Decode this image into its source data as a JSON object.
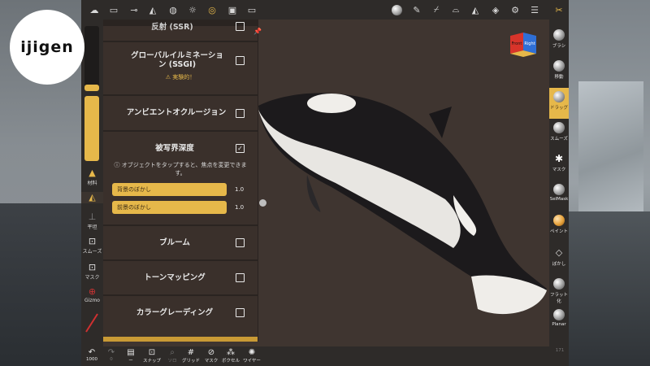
{
  "logo": {
    "text": "ijigen"
  },
  "topbar": {
    "icons": [
      "menu-icon",
      "folder-icon",
      "scene-graph-icon",
      "tools-icon",
      "globe-icon",
      "sun-icon",
      "settings-target-icon",
      "image-icon",
      "video-icon",
      "matcap-sphere-icon",
      "brush-pen-icon",
      "picker-icon",
      "shoe-icon",
      "triangle-icon",
      "layers-icon",
      "gear-icon",
      "sliders-icon",
      "scissors-icon"
    ]
  },
  "viewcube": {
    "left_face": "Front",
    "right_face": "Right"
  },
  "leftcol": {
    "material_label": "材料",
    "flatten_label": "平坦",
    "smooth_label": "スムーズ",
    "mask_label": "マスク",
    "gizmo_label": "Gizmo"
  },
  "panel": {
    "ssr_label": "反射 (SSR)",
    "ssgi_label": "グローバルイルミネーション (SSGI)",
    "ssgi_warning": "⚠ 実験的！",
    "ao_label": "アンビエントオクルージョン",
    "dof_label": "被写界深度",
    "dof_hint": "ⓘ オブジェクトをタップすると、焦点を変更できます。",
    "bg_blur_label": "背景のぼかし",
    "bg_blur_value": "1.0",
    "fg_blur_label": "前景のぼかし",
    "fg_blur_value": "1.0",
    "bloom_label": "ブルーム",
    "tonemap_label": "トーンマッピング",
    "grading_label": "カラーグレーディング"
  },
  "rightcol": {
    "items": [
      "ブラシ",
      "移動",
      "ドラッグ",
      "スムーズ",
      "マスク",
      "SelMask",
      "ペイント",
      "ぼかし",
      "フラット化",
      "Planar"
    ]
  },
  "bottombar": {
    "undo_count": "1000",
    "redo_label": "0",
    "items": [
      "ー",
      "スナップ",
      "ソロ",
      "グリッド",
      "マスク",
      "ボクセル",
      "ワイヤー"
    ],
    "right_label": "171"
  },
  "colors": {
    "accent": "#e6b84a",
    "panel": "#3a302b",
    "toolbar": "#2e2b29"
  }
}
